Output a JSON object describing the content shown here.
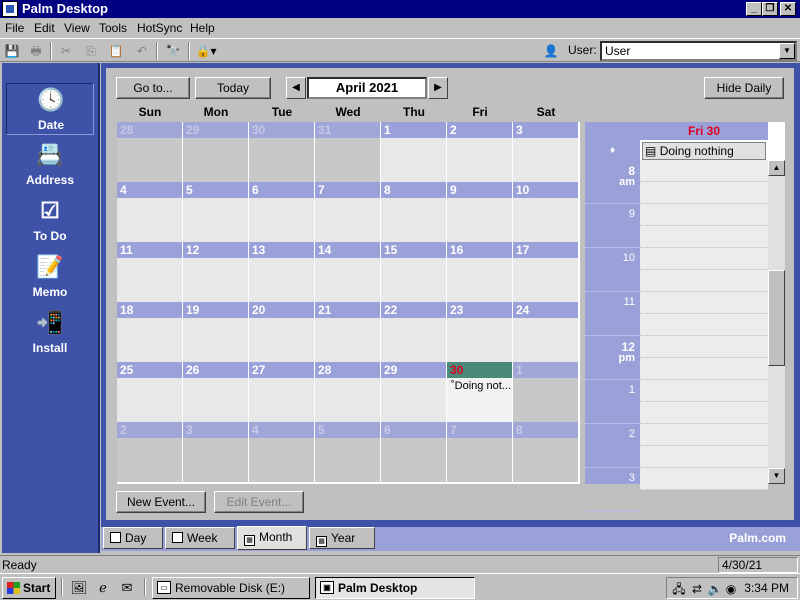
{
  "window": {
    "title": "Palm Desktop",
    "min": "_",
    "max": "❐",
    "close": "✕"
  },
  "menu": [
    "File",
    "Edit",
    "View",
    "Tools",
    "HotSync",
    "Help"
  ],
  "toolbar": {
    "user_label": "User:",
    "user_value": "User"
  },
  "sidebar": [
    {
      "label": "Date",
      "icon": "clock-calendar-icon",
      "glyph": "🕓"
    },
    {
      "label": "Address",
      "icon": "address-card-icon",
      "glyph": "📇"
    },
    {
      "label": "To Do",
      "icon": "checklist-icon",
      "glyph": "☑"
    },
    {
      "label": "Memo",
      "icon": "memo-pad-icon",
      "glyph": "📝"
    },
    {
      "label": "Install",
      "icon": "install-icon",
      "glyph": "📲"
    }
  ],
  "nav": {
    "goto": "Go to...",
    "today": "Today",
    "month": "April 2021",
    "hide_daily": "Hide Daily"
  },
  "weekdays": [
    "Sun",
    "Mon",
    "Tue",
    "Wed",
    "Thu",
    "Fri",
    "Sat"
  ],
  "weeks": [
    [
      {
        "d": "28",
        "o": true
      },
      {
        "d": "29",
        "o": true
      },
      {
        "d": "30",
        "o": true
      },
      {
        "d": "31",
        "o": true
      },
      {
        "d": "1"
      },
      {
        "d": "2"
      },
      {
        "d": "3"
      }
    ],
    [
      {
        "d": "4"
      },
      {
        "d": "5"
      },
      {
        "d": "6"
      },
      {
        "d": "7"
      },
      {
        "d": "8"
      },
      {
        "d": "9"
      },
      {
        "d": "10"
      }
    ],
    [
      {
        "d": "11"
      },
      {
        "d": "12"
      },
      {
        "d": "13"
      },
      {
        "d": "14"
      },
      {
        "d": "15"
      },
      {
        "d": "16"
      },
      {
        "d": "17"
      }
    ],
    [
      {
        "d": "18"
      },
      {
        "d": "19"
      },
      {
        "d": "20"
      },
      {
        "d": "21"
      },
      {
        "d": "22"
      },
      {
        "d": "23"
      },
      {
        "d": "24"
      }
    ],
    [
      {
        "d": "25"
      },
      {
        "d": "26"
      },
      {
        "d": "27"
      },
      {
        "d": "28"
      },
      {
        "d": "29"
      },
      {
        "d": "30",
        "today": true,
        "event": "˚Doing not..."
      },
      {
        "d": "1",
        "o": true
      }
    ],
    [
      {
        "d": "2",
        "o": true
      },
      {
        "d": "3",
        "o": true
      },
      {
        "d": "4",
        "o": true
      },
      {
        "d": "5",
        "o": true
      },
      {
        "d": "6",
        "o": true
      },
      {
        "d": "7",
        "o": true
      },
      {
        "d": "8",
        "o": true
      }
    ]
  ],
  "daily": {
    "header": "Fri 30",
    "untimed_marker": "♦",
    "untimed_event": "Doing nothing",
    "times": [
      {
        "h": "8",
        "p": "am"
      },
      {
        "h": "9",
        "p": ""
      },
      {
        "h": "10",
        "p": ""
      },
      {
        "h": "11",
        "p": ""
      },
      {
        "h": "12",
        "p": "pm"
      },
      {
        "h": "1",
        "p": ""
      },
      {
        "h": "2",
        "p": ""
      },
      {
        "h": "3",
        "p": ""
      }
    ]
  },
  "bottom": {
    "new_event": "New Event...",
    "edit_event": "Edit Event..."
  },
  "tabs": [
    {
      "label": "Day",
      "icon": "day-view-icon",
      "sel": false
    },
    {
      "label": "Week",
      "icon": "week-view-icon",
      "sel": false
    },
    {
      "label": "Month",
      "icon": "month-view-icon",
      "sel": true
    },
    {
      "label": "Year",
      "icon": "year-view-icon",
      "sel": false
    }
  ],
  "brand": "Palm.com",
  "status": {
    "text": "Ready",
    "date": "4/30/21"
  },
  "taskbar": {
    "start": "Start",
    "tasks": [
      {
        "label": "Removable Disk (E:)",
        "icon": "drive-icon",
        "active": false
      },
      {
        "label": "Palm Desktop",
        "icon": "palm-desktop-icon",
        "active": true
      }
    ],
    "clock": "3:34 PM"
  }
}
